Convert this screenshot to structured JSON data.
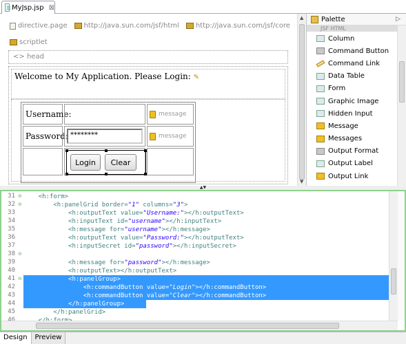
{
  "editor_tab": {
    "label": "MyJsp.jsp",
    "close": "⊠"
  },
  "design": {
    "directives": [
      "directive.page",
      "http://java.sun.com/jsf/html",
      "http://java.sun.com/jsf/core"
    ],
    "scriptlet": "scriptlet",
    "head": "head",
    "head_prefix": "<>",
    "welcome": "Welcome to My Application. Please Login:",
    "username_label": "Username:",
    "password_label": "Password:",
    "password_value": "********",
    "message": "message",
    "login_button": "Login",
    "clear_button": "Clear"
  },
  "palette": {
    "title": "Palette",
    "section": "JSF HTML",
    "items": [
      {
        "label": "Column",
        "icon": "column-icon"
      },
      {
        "label": "Command Button",
        "icon": "command-button-icon"
      },
      {
        "label": "Command Link",
        "icon": "command-link-icon"
      },
      {
        "label": "Data Table",
        "icon": "data-table-icon"
      },
      {
        "label": "Form",
        "icon": "form-icon"
      },
      {
        "label": "Graphic Image",
        "icon": "graphic-image-icon"
      },
      {
        "label": "Hidden Input",
        "icon": "hidden-input-icon"
      },
      {
        "label": "Message",
        "icon": "message-icon"
      },
      {
        "label": "Messages",
        "icon": "messages-icon"
      },
      {
        "label": "Output Format",
        "icon": "output-format-icon"
      },
      {
        "label": "Output Label",
        "icon": "output-label-icon"
      },
      {
        "label": "Output Link",
        "icon": "output-link-icon"
      }
    ]
  },
  "source": {
    "lines": [
      {
        "no": "31",
        "fold": "⊖",
        "indent": 4,
        "text": "<h:form>",
        "sel": false
      },
      {
        "no": "32",
        "fold": "⊖",
        "indent": 8,
        "text": "<h:panelGrid border=\"1\" columns=\"3\">",
        "sel": false
      },
      {
        "no": "33",
        "fold": "",
        "indent": 12,
        "text": "<h:outputText value=\"Username:\"></h:outputText>",
        "sel": false
      },
      {
        "no": "34",
        "fold": "",
        "indent": 12,
        "text": "<h:inputText id=\"username\"></h:inputText>",
        "sel": false
      },
      {
        "no": "35",
        "fold": "",
        "indent": 12,
        "text": "<h:message for=\"username\"></h:message>",
        "sel": false
      },
      {
        "no": "36",
        "fold": "",
        "indent": 12,
        "text": "<h:outputText value=\"Password:\"></h:outputText>",
        "sel": false
      },
      {
        "no": "37",
        "fold": "",
        "indent": 12,
        "text": "<h:inputSecret id=\"password\"></h:inputSecret>",
        "sel": false
      },
      {
        "no": "38",
        "fold": "⊖",
        "indent": 0,
        "text": "",
        "sel": false
      },
      {
        "no": "39",
        "fold": "",
        "indent": 12,
        "text": "<h:message for=\"password\"></h:message>",
        "sel": false
      },
      {
        "no": "40",
        "fold": "",
        "indent": 12,
        "text": "<h:outputText></h:outputText>",
        "sel": false
      },
      {
        "no": "41",
        "fold": "⊖",
        "indent": 12,
        "text": "<h:panelGroup>",
        "sel": true
      },
      {
        "no": "42",
        "fold": "",
        "indent": 16,
        "text": "<h:commandButton value=\"Login\"></h:commandButton>",
        "sel": true
      },
      {
        "no": "43",
        "fold": "",
        "indent": 16,
        "text": "<h:commandButton value=\"Clear\"></h:commandButton>",
        "sel": true
      },
      {
        "no": "44",
        "fold": "",
        "indent": 12,
        "text": "</h:panelGroup>",
        "sel": true
      },
      {
        "no": "45",
        "fold": "",
        "indent": 8,
        "text": "</h:panelGrid>",
        "sel": false
      },
      {
        "no": "46",
        "fold": "",
        "indent": 4,
        "text": "</h:form>",
        "sel": false
      }
    ]
  },
  "bottom_tabs": [
    "Design",
    "Preview"
  ]
}
